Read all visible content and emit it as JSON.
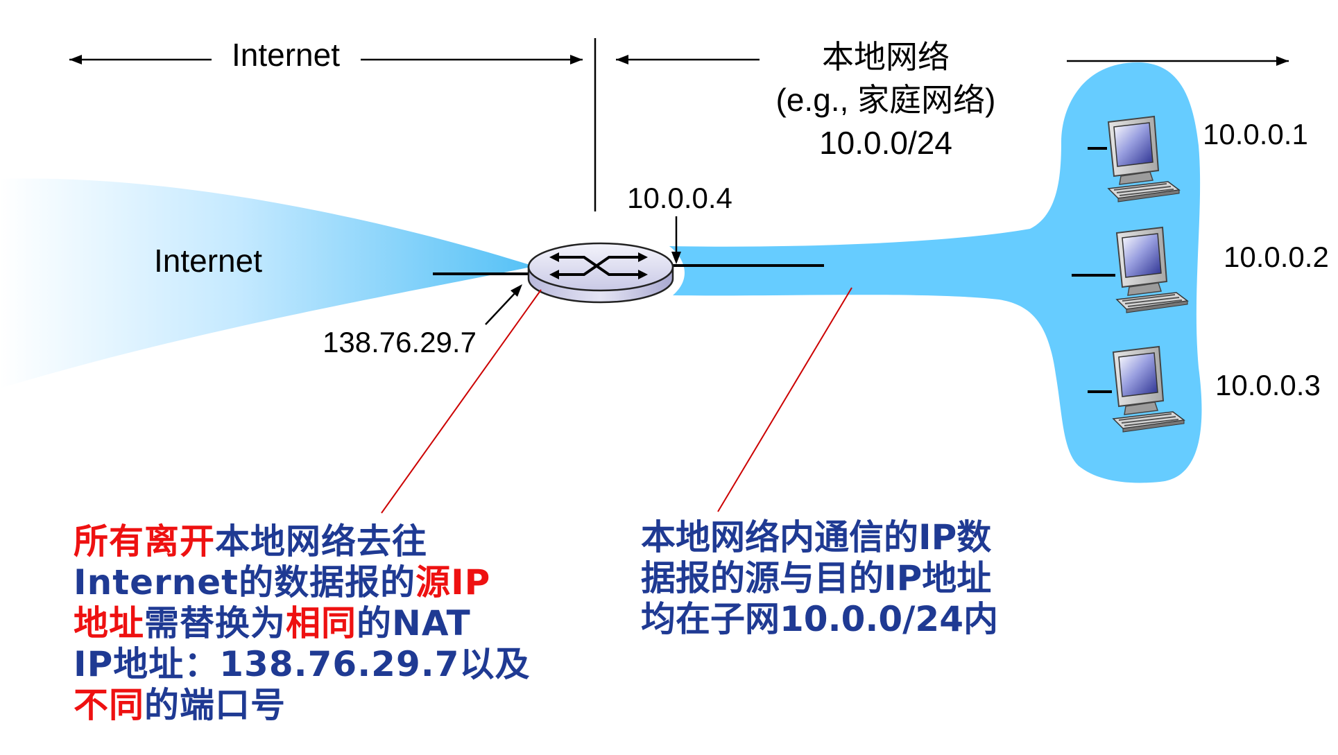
{
  "header": {
    "internet_label": "Internet",
    "local_network_label": "本地网络",
    "local_network_example": "(e.g., 家庭网络)",
    "local_subnet": "10.0.0/24"
  },
  "router": {
    "wan_ip": "138.76.29.7",
    "lan_ip": "10.0.0.4"
  },
  "internet_cloud_label": "Internet",
  "hosts": [
    {
      "ip": "10.0.0.1"
    },
    {
      "ip": "10.0.0.2"
    },
    {
      "ip": "10.0.0.3"
    }
  ],
  "notes": {
    "left": [
      [
        {
          "text": "所有离开",
          "style": "red"
        },
        {
          "text": "本地网络去往",
          "style": "blue"
        }
      ],
      [
        {
          "text": "Internet的数据报的",
          "style": "blue"
        },
        {
          "text": "源IP",
          "style": "red"
        }
      ],
      [
        {
          "text": "地址",
          "style": "red"
        },
        {
          "text": "需替换为",
          "style": "blue"
        },
        {
          "text": "相同",
          "style": "red"
        },
        {
          "text": "的NAT",
          "style": "blue"
        }
      ],
      [
        {
          "text": "IP地址：138.76.29.7以及",
          "style": "blue"
        }
      ],
      [
        {
          "text": "不同",
          "style": "red"
        },
        {
          "text": "的端口号",
          "style": "blue"
        }
      ]
    ],
    "right": [
      "本地网络内通信的IP数",
      "据报的源与目的IP地址",
      "均在子网10.0.0/24内"
    ]
  },
  "colors": {
    "network_fill": "#66ccff",
    "callout_line": "#cc0000",
    "note_blue": "#1f3a93",
    "note_red": "#ee1111"
  }
}
